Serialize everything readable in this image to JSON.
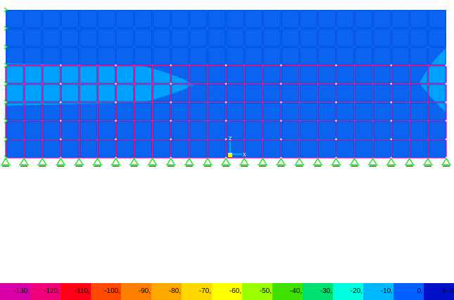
{
  "model_view": {
    "grid_columns": 24,
    "grid_rows": 8,
    "frame_rows": [
      3,
      4,
      5,
      6,
      7
    ],
    "light_regions": [
      "left-lens",
      "right-lens"
    ],
    "colors": {
      "background": "#ffffff",
      "shell_dark": "#0a64f0",
      "shell_light": "#00a0ff",
      "shell_border": "#0040c8",
      "frame": "#d0209a",
      "support": "#1fe61f",
      "axis": "#00d0ff"
    },
    "axis_labels": {
      "z": "Z",
      "x": "X"
    }
  },
  "legend": {
    "segments": [
      {
        "label": "-130,",
        "color": "#d800a8"
      },
      {
        "label": "-120,",
        "color": "#f0007a"
      },
      {
        "label": "-110,",
        "color": "#ff0018"
      },
      {
        "label": "-100,",
        "color": "#ff4800"
      },
      {
        "label": "-90,",
        "color": "#ff8000"
      },
      {
        "label": "-80,",
        "color": "#ffa800"
      },
      {
        "label": "-70,",
        "color": "#ffd800"
      },
      {
        "label": "-60,",
        "color": "#ffff00"
      },
      {
        "label": "-50,",
        "color": "#9cff00"
      },
      {
        "label": "-40,",
        "color": "#40e000"
      },
      {
        "label": "-30,",
        "color": "#00e070"
      },
      {
        "label": "-20,",
        "color": "#00ffe0"
      },
      {
        "label": "-10,",
        "color": "#00b8ff"
      },
      {
        "label": "0,",
        "color": "#0060ff"
      },
      {
        "label": "E-3",
        "color": "#0010c8"
      }
    ]
  }
}
